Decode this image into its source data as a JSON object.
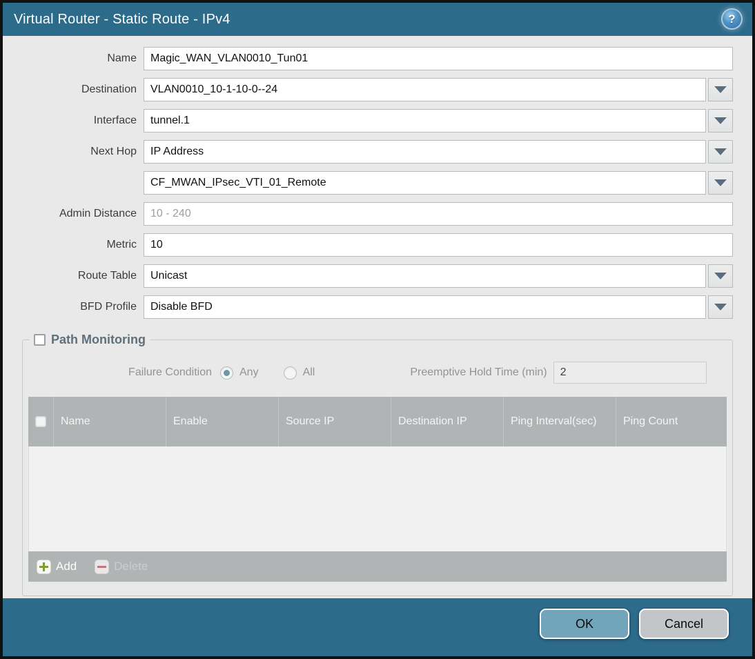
{
  "dialog": {
    "title": "Virtual Router - Static Route - IPv4",
    "help_icon_glyph": "?"
  },
  "form": {
    "name": {
      "label": "Name",
      "value": "Magic_WAN_VLAN0010_Tun01"
    },
    "destination": {
      "label": "Destination",
      "value": "VLAN0010_10-1-10-0--24"
    },
    "interface": {
      "label": "Interface",
      "value": "tunnel.1"
    },
    "next_hop": {
      "label": "Next Hop",
      "value": "IP Address",
      "address_value": "CF_MWAN_IPsec_VTI_01_Remote"
    },
    "admin_distance": {
      "label": "Admin Distance",
      "placeholder": "10 - 240",
      "value": ""
    },
    "metric": {
      "label": "Metric",
      "value": "10"
    },
    "route_table": {
      "label": "Route Table",
      "value": "Unicast"
    },
    "bfd_profile": {
      "label": "BFD Profile",
      "value": "Disable BFD"
    }
  },
  "path_monitoring": {
    "legend": "Path Monitoring",
    "enabled": false,
    "failure_condition": {
      "label": "Failure Condition",
      "options": [
        "Any",
        "All"
      ],
      "selected": "Any"
    },
    "preemptive_hold_time": {
      "label": "Preemptive Hold Time (min)",
      "value": "2"
    },
    "table": {
      "columns": [
        "Name",
        "Enable",
        "Source IP",
        "Destination IP",
        "Ping Interval(sec)",
        "Ping Count"
      ],
      "rows": []
    },
    "toolbar": {
      "add_label": "Add",
      "delete_label": "Delete"
    }
  },
  "footer": {
    "ok_label": "OK",
    "cancel_label": "Cancel"
  },
  "colors": {
    "titlebar": "#2d6b8b",
    "content_bg": "#e9e9e9",
    "grid_header": "#b1b4b5",
    "ok_button": "#72a4ba",
    "cancel_button": "#c3c6c9",
    "add_icon_green": "#7f9c3a",
    "delete_icon_red": "#c86a74"
  }
}
